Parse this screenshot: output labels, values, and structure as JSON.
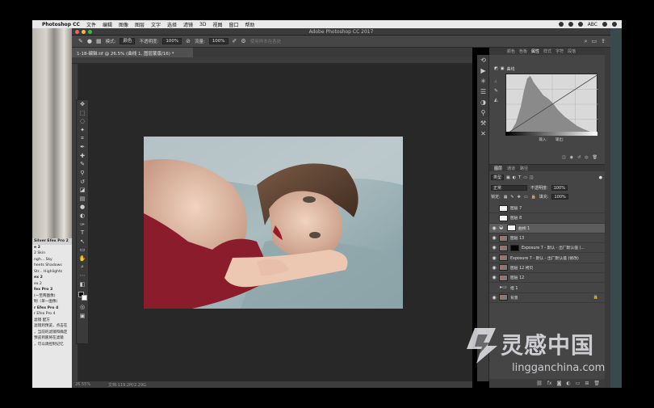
{
  "menubar": {
    "app": "Photoshop CC",
    "items": [
      "文件",
      "编辑",
      "图像",
      "图层",
      "文字",
      "选择",
      "滤镜",
      "3D",
      "视图",
      "窗口",
      "帮助"
    ],
    "right_text": "ABC"
  },
  "window": {
    "title": "Adobe Photoshop CC 2017"
  },
  "options": {
    "mode_label": "模式:",
    "mode_value": "颜色",
    "opacity_label": "不透明度:",
    "opacity_value": "100%",
    "flow_label": "流量:",
    "flow_value": "100%",
    "extra_label": "使用样本在各处"
  },
  "document": {
    "tab_label": "1-18-编辑.tif @ 26.5% (曲线 1, 图层蒙版/16) *",
    "zoom": "26.55%",
    "doc_info": "文档:119.2M/2.29G"
  },
  "properties": {
    "tabs": [
      "颜色",
      "色板",
      "属性",
      "样式",
      "字符",
      "段落"
    ],
    "active_tab": "属性",
    "panel_title": "曲线",
    "input_label": "输入:",
    "output_label": "输出:"
  },
  "layers_panel": {
    "tabs": [
      "图层",
      "通道",
      "路径"
    ],
    "active_tab": "图层",
    "filter_kind": "类型",
    "blend_mode": "正常",
    "opacity_label": "不透明度:",
    "opacity_value": "100%",
    "lock_label": "锁定:",
    "fill_label": "填充:",
    "fill_value": "100%",
    "layers": [
      {
        "name": "图层 7",
        "thumb": "white",
        "visible": false
      },
      {
        "name": "图层 8",
        "thumb": "white",
        "visible": false
      },
      {
        "name": "曲线 1",
        "thumb": "white",
        "visible": true,
        "adjustment": true,
        "active": true
      },
      {
        "name": "图层 13",
        "thumb": "photo",
        "visible": true
      },
      {
        "name": "Exposure 7 - 默认 - 出厂默认值 (...",
        "thumb": "black",
        "visible": true
      },
      {
        "name": "Exposure 7 - 默认 - 出厂默认值 (修改)",
        "thumb": "photo",
        "visible": true
      },
      {
        "name": "图层 12 拷贝",
        "thumb": "photo",
        "visible": true
      },
      {
        "name": "图层 12",
        "thumb": "photo",
        "visible": true
      },
      {
        "name": "组 1",
        "thumb": "folder",
        "visible": false
      },
      {
        "name": "背景",
        "thumb": "photo",
        "visible": true,
        "locked": true
      }
    ]
  },
  "left_panel": {
    "title": "Silver Efex Pro 2",
    "rows": [
      "e 2",
      "2        Skin",
      "ngh...   Sky",
      "heets   Shadows",
      "Str...   Highlights",
      "ex 2",
      "ex 2",
      "fex Pro 2",
      "(一至两图像)",
      "制（单一图像）",
      "r Efex Pro 4",
      "r Efex Pro 4",
      "滤镜    配方",
      "滤镜到预览，点击在",
      "，当前的滤镜和确定",
      "预览到底将在滤镜",
      "，可以调控制记忆"
    ]
  },
  "watermark": {
    "cn": "灵感中国",
    "en": "lingganchina.com"
  }
}
